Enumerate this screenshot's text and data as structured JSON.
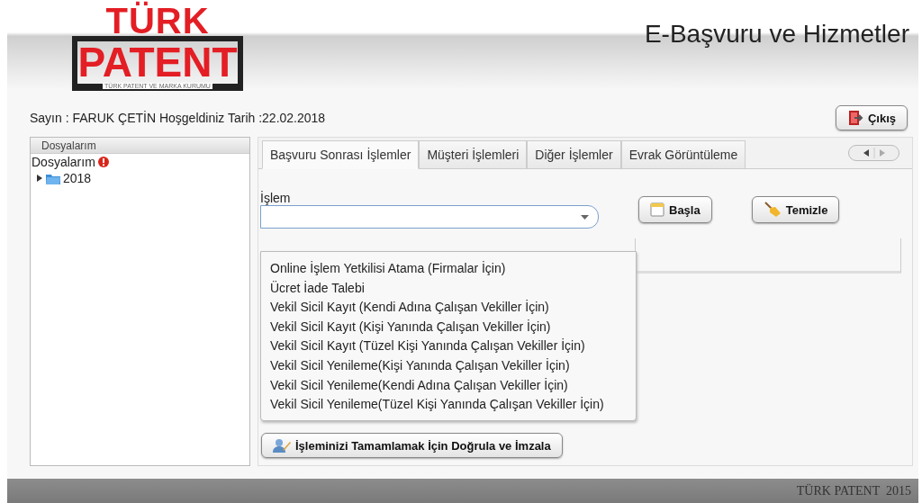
{
  "logo": {
    "line1": "TÜRK",
    "line2": "PATENT",
    "tagline": "TÜRK PATENT VE MARKA KURUMU"
  },
  "header": {
    "title": "E-Başvuru ve Hizmetler"
  },
  "welcome": "Sayın : FARUK ÇETİN Hoşgeldiniz Tarih :22.02.2018",
  "logout_button": "Çıkış",
  "sidebar": {
    "title": "Dosyalarım",
    "tree": [
      {
        "label": "Dosyalarım",
        "alert": true,
        "children": [
          {
            "label": "2018",
            "expanded": false,
            "alert": false
          }
        ]
      }
    ]
  },
  "tabs": [
    {
      "label": "Başvuru Sonrası İşlemler",
      "selected": true
    },
    {
      "label": "Müşteri İşlemleri",
      "selected": false
    },
    {
      "label": "Diğer İşlemler",
      "selected": false
    },
    {
      "label": "Evrak Görüntüleme",
      "selected": false
    }
  ],
  "form": {
    "label": "İşlem",
    "start_button": "Başla",
    "clear_button": "Temizle"
  },
  "dropdown_options": [
    "Online İşlem Yetkilisi Atama (Firmalar İçin)",
    "Ücret İade Talebi",
    "Vekil Sicil Kayıt (Kendi Adına Çalışan Vekiller İçin)",
    "Vekil Sicil Kayıt (Kişi Yanında Çalışan Vekiller İçin)",
    "Vekil Sicil Kayıt (Tüzel Kişi Yanında Çalışan Vekiller İçin)",
    "Vekil Sicil Yenileme(Kişi Yanında Çalışan Vekiller İçin)",
    "Vekil Sicil Yenileme(Kendi Adına Çalışan Vekiller İçin)",
    "Vekil Sicil Yenileme(Tüzel Kişi Yanında Çalışan Vekiller İçin)"
  ],
  "sign_button": "İşleminizi Tamamlamak İçin Doğrula ve İmzala",
  "footer": "TÜRK PATENT  2015"
}
